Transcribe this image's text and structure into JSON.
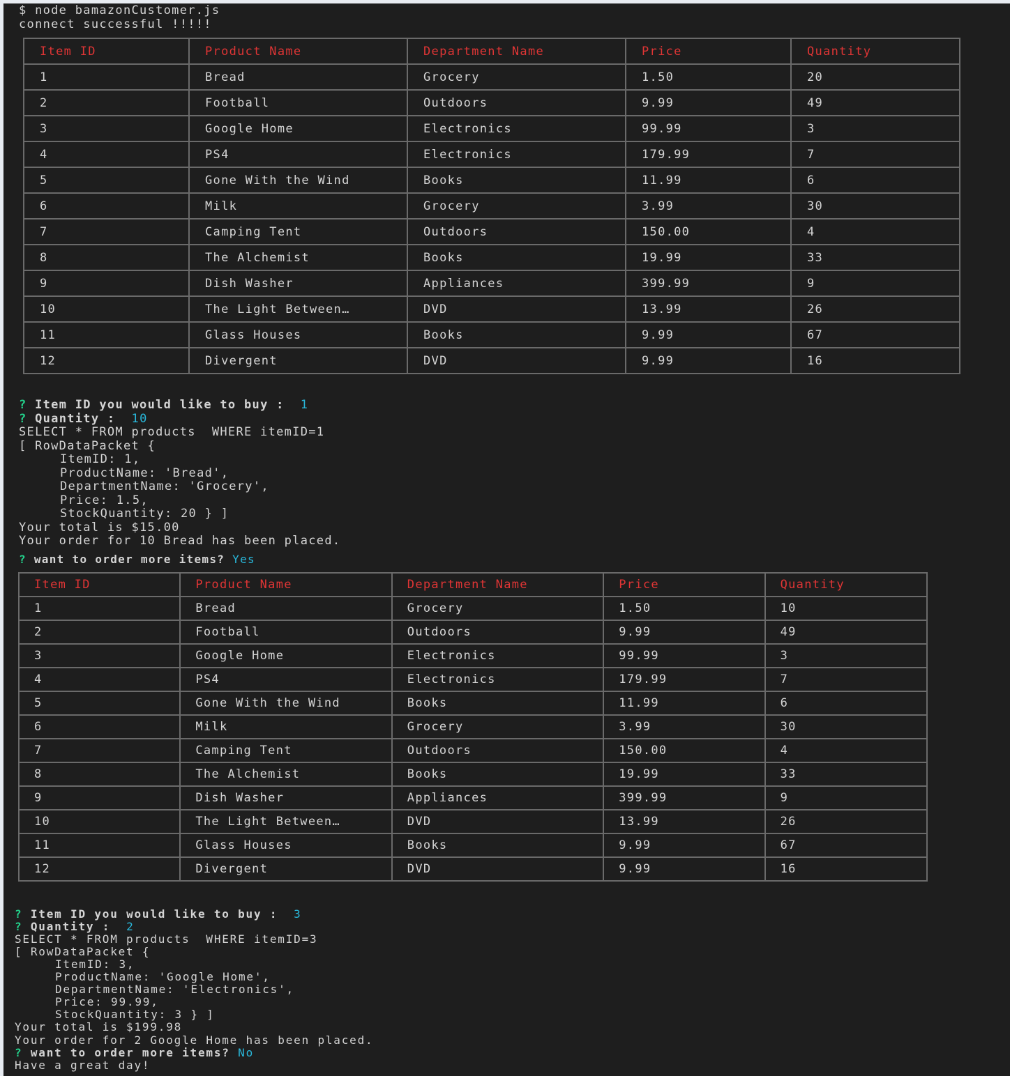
{
  "terminal": {
    "command": "$ node bamazonCustomer.js",
    "connect_message": "connect successful !!!!!"
  },
  "table_headers": [
    "Item ID",
    "Product Name",
    "Department Name",
    "Price",
    "Quantity"
  ],
  "inventory_before": [
    [
      "1",
      "Bread",
      "Grocery",
      "1.50",
      "20"
    ],
    [
      "2",
      "Football",
      "Outdoors",
      "9.99",
      "49"
    ],
    [
      "3",
      "Google Home",
      "Electronics",
      "99.99",
      "3"
    ],
    [
      "4",
      "PS4",
      "Electronics",
      "179.99",
      "7"
    ],
    [
      "5",
      "Gone With the Wind",
      "Books",
      "11.99",
      "6"
    ],
    [
      "6",
      "Milk",
      "Grocery",
      "3.99",
      "30"
    ],
    [
      "7",
      "Camping Tent",
      "Outdoors",
      "150.00",
      "4"
    ],
    [
      "8",
      "The Alchemist",
      "Books",
      "19.99",
      "33"
    ],
    [
      "9",
      "Dish Washer",
      "Appliances",
      "399.99",
      "9"
    ],
    [
      "10",
      "The Light Between…",
      "DVD",
      "13.99",
      "26"
    ],
    [
      "11",
      "Glass Houses",
      "Books",
      "9.99",
      "67"
    ],
    [
      "12",
      "Divergent",
      "DVD",
      "9.99",
      "16"
    ]
  ],
  "order1": {
    "prompt_symbol": "?",
    "item_question": "Item ID you would like to buy :",
    "item_answer": "1",
    "quantity_question": "Quantity :",
    "quantity_answer": "10",
    "sql": "SELECT * FROM products  WHERE itemID=1",
    "packet_open": "[ RowDataPacket {",
    "field_item_id": "ItemID: 1,",
    "field_product_name": "ProductName: 'Bread',",
    "field_department": "DepartmentName: 'Grocery',",
    "field_price": "Price: 1.5,",
    "field_stock": "StockQuantity: 20 } ]",
    "total": "Your total is $15.00",
    "placed": "Your order for 10 Bread has been placed.",
    "more_question": "want to order more items?",
    "more_answer": "Yes"
  },
  "inventory_after": [
    [
      "1",
      "Bread",
      "Grocery",
      "1.50",
      "10"
    ],
    [
      "2",
      "Football",
      "Outdoors",
      "9.99",
      "49"
    ],
    [
      "3",
      "Google Home",
      "Electronics",
      "99.99",
      "3"
    ],
    [
      "4",
      "PS4",
      "Electronics",
      "179.99",
      "7"
    ],
    [
      "5",
      "Gone With the Wind",
      "Books",
      "11.99",
      "6"
    ],
    [
      "6",
      "Milk",
      "Grocery",
      "3.99",
      "30"
    ],
    [
      "7",
      "Camping Tent",
      "Outdoors",
      "150.00",
      "4"
    ],
    [
      "8",
      "The Alchemist",
      "Books",
      "19.99",
      "33"
    ],
    [
      "9",
      "Dish Washer",
      "Appliances",
      "399.99",
      "9"
    ],
    [
      "10",
      "The Light Between…",
      "DVD",
      "13.99",
      "26"
    ],
    [
      "11",
      "Glass Houses",
      "Books",
      "9.99",
      "67"
    ],
    [
      "12",
      "Divergent",
      "DVD",
      "9.99",
      "16"
    ]
  ],
  "order2": {
    "prompt_symbol": "?",
    "item_question": "Item ID you would like to buy :",
    "item_answer": "3",
    "quantity_question": "Quantity :",
    "quantity_answer": "2",
    "sql": "SELECT * FROM products  WHERE itemID=3",
    "packet_open": "[ RowDataPacket {",
    "field_item_id": "ItemID: 3,",
    "field_product_name": "ProductName: 'Google Home',",
    "field_department": "DepartmentName: 'Electronics',",
    "field_price": "Price: 99.99,",
    "field_stock": "StockQuantity: 3 } ]",
    "total": "Your total is $199.98",
    "placed": "Your order for 2 Google Home has been placed.",
    "more_question": "want to order more items?",
    "more_answer": "No"
  },
  "farewell": "Have a great day!"
}
